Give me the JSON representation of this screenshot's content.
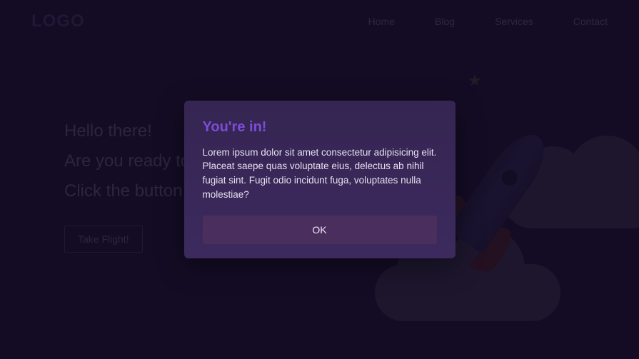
{
  "header": {
    "logo": "LOGO",
    "nav": [
      "Home",
      "Blog",
      "Services",
      "Contact"
    ]
  },
  "hero": {
    "line1": "Hello there!",
    "line2": "Are you ready to start?",
    "line3": "Click the button below",
    "cta": "Take Flight!"
  },
  "modal": {
    "title": "You're in!",
    "body": "Lorem ipsum dolor sit amet consectetur adipisicing elit. Placeat saepe quas voluptate eius, delectus ab nihil fugiat sint. Fugit odio incidunt fuga, voluptates nulla molestiae?",
    "ok": "OK"
  }
}
